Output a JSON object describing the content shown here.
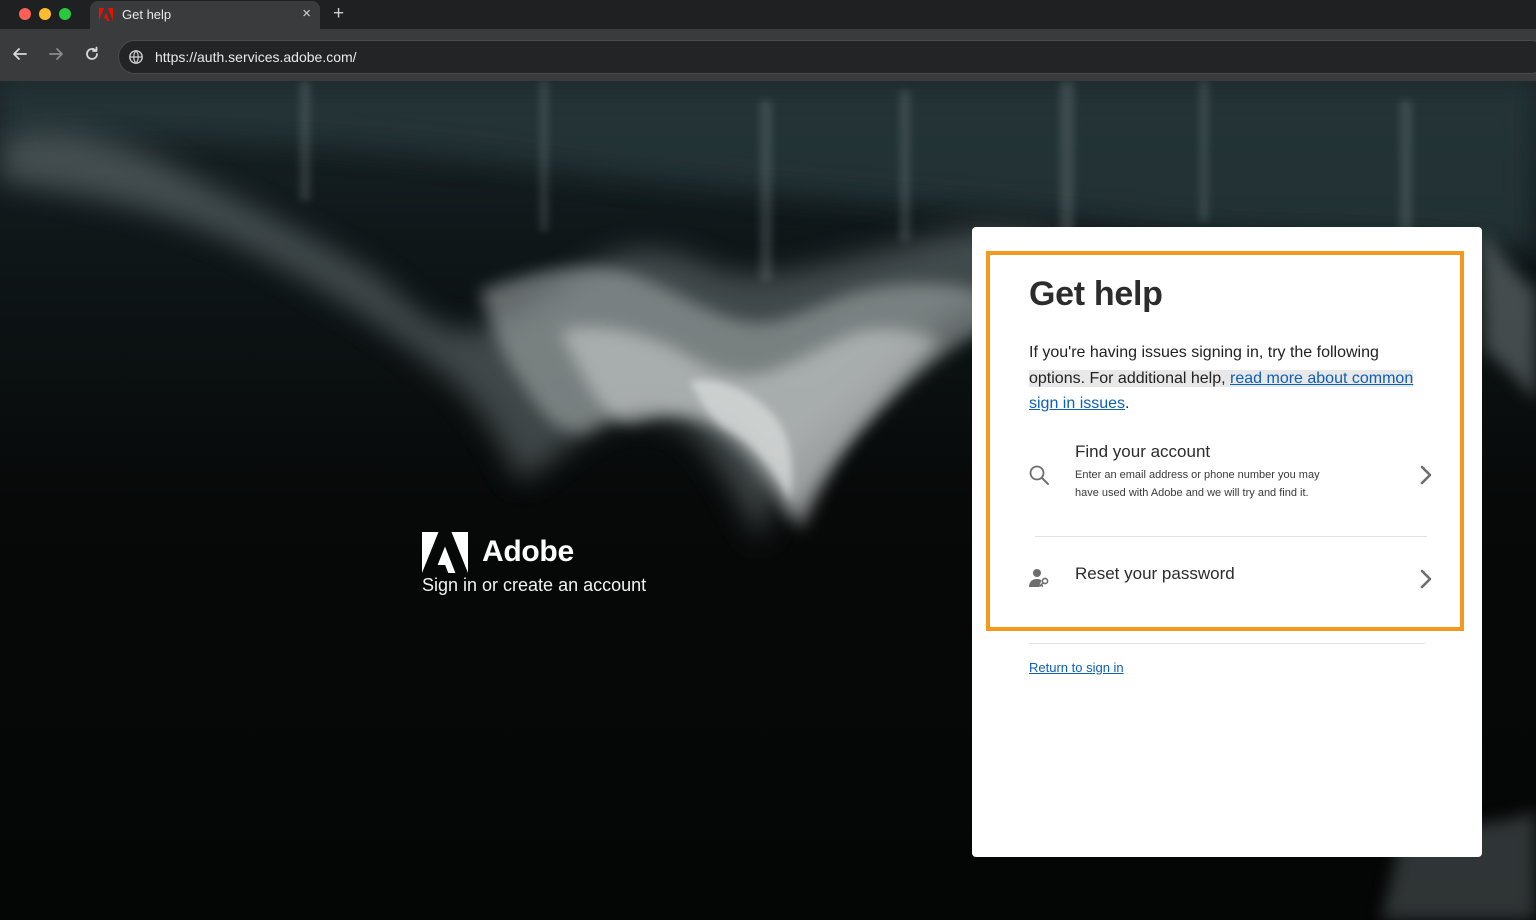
{
  "browser": {
    "tab_title": "Get help",
    "tab_close": "×",
    "new_tab": "+",
    "url": "https://auth.services.adobe.com/"
  },
  "brand": {
    "name": "Adobe",
    "tagline": "Sign in or create an account"
  },
  "card": {
    "title": "Get help",
    "description_plain": "If you're having issues signing in, try the following",
    "description_hl": "options. For additional help, ",
    "description_link": "read more about common",
    "description_link2": "sign in issues",
    "description_end": ".",
    "options": [
      {
        "title": "Find your account",
        "subtitle": "Enter an email address or phone number you may have used with Adobe and we will try and find it.",
        "icon": "search-icon"
      },
      {
        "title": "Reset your password",
        "icon": "user-key-icon"
      }
    ],
    "return_link": "Return to sign in"
  },
  "colors": {
    "highlight_border": "#f39a1e",
    "link": "#0d5fb5",
    "adobe_red": "#eb1000"
  }
}
